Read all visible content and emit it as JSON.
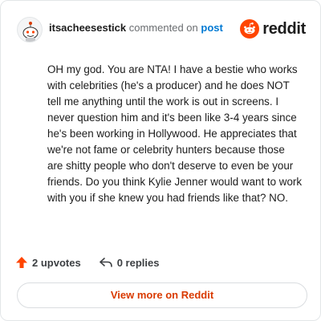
{
  "header": {
    "username": "itsacheesestick",
    "action_text": "commented on",
    "target_text": "post",
    "logo_word": "reddit"
  },
  "comment": {
    "body": "OH my god. You are NTA! I have a bestie who works with celebrities (he's a producer) and he does NOT tell me anything until the work is out in screens. I never question him and it's been like 3-4 years since he's been working in Hollywood. He appreciates that we're not fame or celebrity hunters because those are shitty people who don't deserve to even be your friends. Do you think Kylie Jenner would want to work with you if she knew you had friends like that? NO."
  },
  "actions": {
    "upvotes_label": "2 upvotes",
    "replies_label": "0 replies"
  },
  "footer": {
    "view_more_label": "View more on Reddit"
  },
  "colors": {
    "brand": "#ff4500",
    "link": "#0079d3",
    "cta_text": "#d93a00"
  },
  "icons": {
    "avatar": "snoo-avatar",
    "logo": "reddit-logo-icon",
    "upvote": "upvote-arrow-icon",
    "reply": "reply-arrow-icon"
  }
}
